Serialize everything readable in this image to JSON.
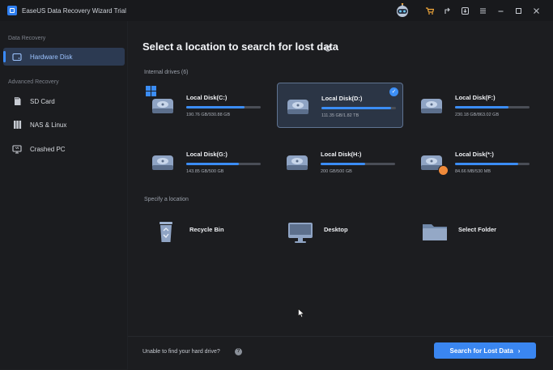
{
  "window": {
    "title": "EaseUS Data Recovery Wizard Trial"
  },
  "titlebar": {
    "icons": [
      "robot-icon",
      "cart-icon",
      "share-icon",
      "download-icon",
      "menu-icon",
      "minimize-icon",
      "maximize-icon",
      "close-icon"
    ]
  },
  "sidebar": {
    "section_recovery": "Data Recovery",
    "section_advanced": "Advanced Recovery",
    "items": [
      {
        "label": "Hardware Disk",
        "icon": "hard-disk-icon",
        "active": true
      },
      {
        "label": "SD Card",
        "icon": "sd-card-icon",
        "active": false
      },
      {
        "label": "NAS & Linux",
        "icon": "nas-icon",
        "active": false
      },
      {
        "label": "Crashed PC",
        "icon": "crashed-pc-icon",
        "active": false
      }
    ]
  },
  "main": {
    "heading": "Select a location to search for lost data",
    "internal_label": "Internal drives (6)",
    "drives": [
      {
        "name": "Local Disk(C:)",
        "size": "190.76 GB/930.88 GB",
        "used_fraction": 0.78,
        "selected": false,
        "badge": "windows"
      },
      {
        "name": "Local Disk(D:)",
        "size": "111.35 GB/1.82 TB",
        "used_fraction": 0.93,
        "selected": true,
        "badge": "check"
      },
      {
        "name": "Local Disk(F:)",
        "size": "230.18 GB/863.02 GB",
        "used_fraction": 0.72,
        "selected": false,
        "badge": ""
      },
      {
        "name": "Local Disk(G:)",
        "size": "143.85 GB/500 GB",
        "used_fraction": 0.71,
        "selected": false,
        "badge": ""
      },
      {
        "name": "Local Disk(H:)",
        "size": "200 GB/500 GB",
        "used_fraction": 0.6,
        "selected": false,
        "badge": ""
      },
      {
        "name": "Local Disk(*:)",
        "size": "84.66 MB/530 MB",
        "used_fraction": 0.85,
        "selected": false,
        "badge": "warning"
      }
    ],
    "specify_label": "Specify a location",
    "locations": [
      {
        "label": "Recycle Bin",
        "icon": "recycle-bin-icon"
      },
      {
        "label": "Desktop",
        "icon": "desktop-icon"
      },
      {
        "label": "Select Folder",
        "icon": "folder-icon"
      }
    ]
  },
  "footer": {
    "hint": "Unable to find your hard drive?",
    "search_button": "Search for Lost Data"
  },
  "colors": {
    "accent": "#3a86f0",
    "warning": "#f08a3a",
    "cart": "#f2a93b"
  }
}
